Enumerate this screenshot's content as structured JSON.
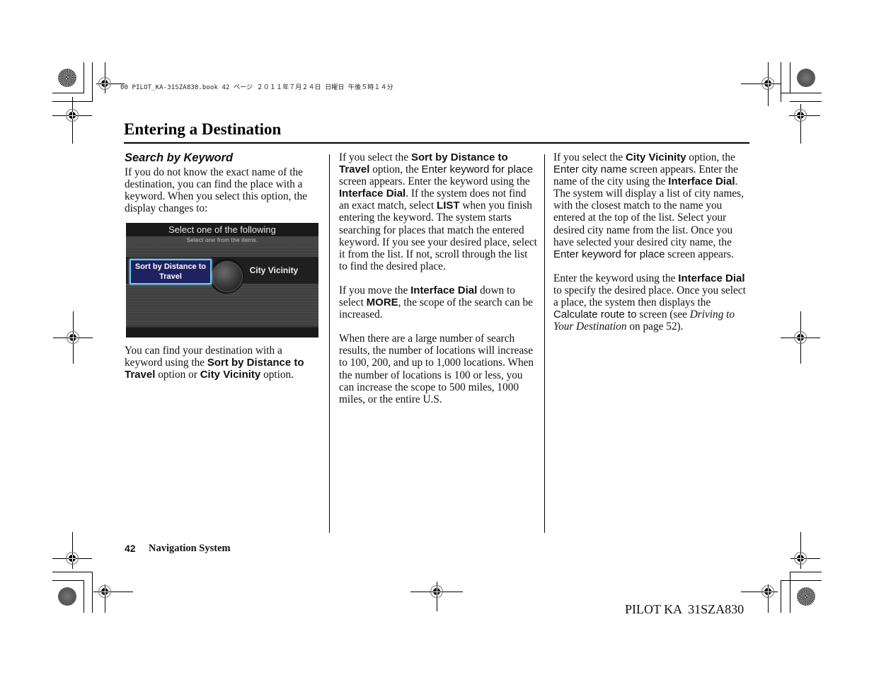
{
  "slug_line": "00 PILOT_KA-31SZA830.book  42 ページ  ２０１１年７月２４日  日曜日  午後５時１４分",
  "page_title": "Entering a Destination",
  "section": {
    "heading": "Search by Keyword",
    "intro": "If you do not know the exact name of the destination, you can find the place with a keyword. When you select this option, the display changes to:",
    "after_screen": {
      "t1": "You can find your destination with a keyword using the ",
      "b1": "Sort by Distance to Travel",
      "t2": " option or ",
      "b2": "City Vicinity",
      "t3": " option."
    }
  },
  "nav_screen": {
    "title": "Select one of the following",
    "subtitle": "Select one from the items.",
    "options": [
      {
        "label": "Sort by Distance to Travel",
        "selected": true
      },
      {
        "label": "City Vicinity",
        "selected": false
      }
    ],
    "colors": {
      "selected_fill": "#1e2260",
      "selected_border": "#6ec6f0"
    }
  },
  "col2": {
    "p1": {
      "t1": "If you select the ",
      "b1": "Sort by Distance to Travel",
      "t2": " option, the ",
      "s1": "Enter keyword for place",
      "t3": " screen appears. Enter the keyword using the ",
      "b2": "Interface Dial",
      "t4": ". If the system does not find an exact match, select ",
      "b3": "LIST",
      "t5": " when you finish entering the keyword. The system starts searching for places that match the entered keyword. If you see your desired place, select it from the list. If not, scroll through the list to find the desired place."
    },
    "p2": {
      "t1": "If you move the ",
      "b1": "Interface Dial",
      "t2": " down to select ",
      "b2": "MORE",
      "t3": ", the scope of the search can be increased."
    },
    "p3": "When there are a large number of search results, the number of locations will increase to 100, 200, and up to 1,000 locations. When the number of locations is 100 or less, you can increase the scope to 500 miles, 1000 miles, or the entire U.S."
  },
  "col3": {
    "p1": {
      "t1": "If you select the ",
      "b1": "City Vicinity",
      "t2": " option, the ",
      "s1": "Enter city name",
      "t3": " screen appears. Enter the name of the city using the ",
      "b2": "Interface Dial",
      "t4": ". The system will display a list of city names, with the closest match to the name you entered at the top of the list. Select your desired city name from the list. Once you have selected your desired city name, the ",
      "s2": "Enter keyword for place",
      "t5": " screen appears."
    },
    "p2": {
      "t1": "Enter the keyword using the ",
      "b1": "Interface Dial",
      "t2": " to specify the desired place. Once you select a place, the system then displays the ",
      "s1": "Calculate route to",
      "t3": " screen (see ",
      "i1": "Driving to Your Destination",
      "t4": " on page 52)."
    }
  },
  "footer": {
    "page_number": "42",
    "section_label": "Navigation System",
    "doc_code": "PILOT KA  31SZA830"
  }
}
